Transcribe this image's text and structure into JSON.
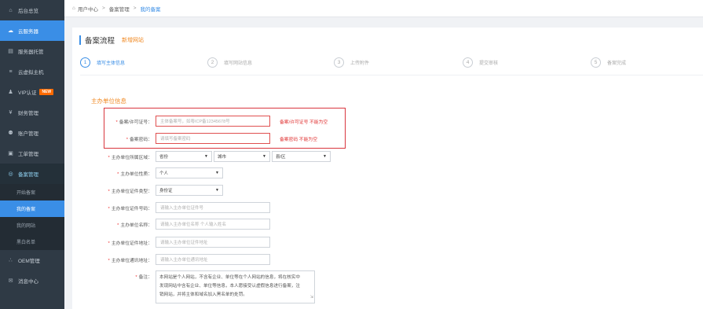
{
  "sidebar": {
    "items": [
      {
        "label": "后台总览",
        "icon": "home-icon",
        "glyph": "⌂"
      },
      {
        "label": "云服务器",
        "icon": "cloud-icon",
        "glyph": "☁"
      },
      {
        "label": "服务器托管",
        "icon": "server-icon",
        "glyph": "▤"
      },
      {
        "label": "云虚拟主机",
        "icon": "host-icon",
        "glyph": "≡"
      },
      {
        "label": "VIP认证",
        "icon": "user-icon",
        "glyph": "♟",
        "badge": "NEW"
      },
      {
        "label": "财务管理",
        "icon": "yen-icon",
        "glyph": "¥"
      },
      {
        "label": "账户管理",
        "icon": "key-icon",
        "glyph": "⚉"
      },
      {
        "label": "工单管理",
        "icon": "ticket-icon",
        "glyph": "▣"
      },
      {
        "label": "备案管理",
        "icon": "record-icon",
        "glyph": "◎"
      }
    ],
    "sub_items": [
      "开始备案",
      "我的备案",
      "我的网站",
      "黑白名单"
    ],
    "bottom_items": [
      {
        "label": "OEM管理",
        "icon": "share-icon",
        "glyph": "∴"
      },
      {
        "label": "消息中心",
        "icon": "message-icon",
        "glyph": "✉"
      }
    ]
  },
  "breadcrumb": {
    "home": "用户中心",
    "sep": ">",
    "level2": "备案管理",
    "current": "我的备案"
  },
  "panel": {
    "title": "备案流程",
    "subtitle": "新增网站"
  },
  "steps": [
    {
      "num": "1",
      "label": "填写主体信息"
    },
    {
      "num": "2",
      "label": "填写网站信息"
    },
    {
      "num": "3",
      "label": "上传附件"
    },
    {
      "num": "4",
      "label": "提交审核"
    },
    {
      "num": "5",
      "label": "备案完成"
    }
  ],
  "form": {
    "section_title": "主办单位信息",
    "license": {
      "label": "备案/许可证号：",
      "placeholder": "主体备案号，如粤ICP备12345678号",
      "error": "备案/许可证号 不能为空"
    },
    "password": {
      "label": "备案密码：",
      "placeholder": "请填写备案密码",
      "error": "备案密码 不能为空"
    },
    "region": {
      "label": "主办单位所属区域：",
      "province": "省份",
      "city": "城市",
      "district": "县/区"
    },
    "nature": {
      "label": "主办单位性质：",
      "value": "个人"
    },
    "cert_type": {
      "label": "主办单位证件类型：",
      "value": "身份证"
    },
    "cert_no": {
      "label": "主办单位证件号码：",
      "placeholder": "请输入主办单位证件号"
    },
    "name": {
      "label": "主办单位名称：",
      "placeholder": "请输入主办单位名称 个人输入姓名"
    },
    "cert_addr": {
      "label": "主办单位证件地址：",
      "placeholder": "请输入主办单位证件地址"
    },
    "mail_addr": {
      "label": "主办单位通讯地址：",
      "placeholder": "请输入主办单位通讯地址"
    },
    "remark": {
      "label": "备注：",
      "line1": "本网站是个人网站，不含有企业、单位等在个人网站的信息，将在核实中",
      "line2": "发现网站中含有企业、单位等信息，本人愿接受认虚假信息进行备案，注",
      "line3": "销网站，并将主体和域名加入黑名单的处罚。"
    }
  }
}
